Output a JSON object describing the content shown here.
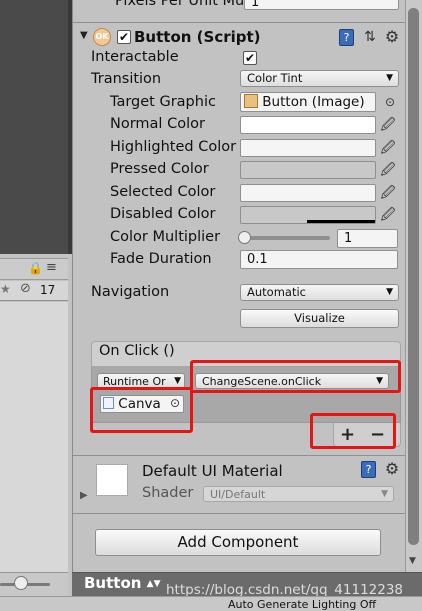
{
  "inspector": {
    "top_label": "Pixels Per Unit Mult",
    "top_value": "1",
    "component": {
      "title": "Button (Script)",
      "enabled": true
    },
    "interactable": {
      "label": "Interactable",
      "checked": true
    },
    "transition": {
      "label": "Transition",
      "value": "Color Tint"
    },
    "target_graphic": {
      "label": "Target Graphic",
      "value": "Button (Image)"
    },
    "normal_color": {
      "label": "Normal Color",
      "color": "#ffffff"
    },
    "highlighted_color": {
      "label": "Highlighted Color",
      "color": "#f5f5f5"
    },
    "pressed_color": {
      "label": "Pressed Color",
      "color": "#c8c8c8"
    },
    "selected_color": {
      "label": "Selected Color",
      "color": "#f5f5f5"
    },
    "disabled_color": {
      "label": "Disabled Color",
      "color": "#c8c8c8"
    },
    "color_multiplier": {
      "label": "Color Multiplier",
      "value": "1",
      "slider_fraction": 0
    },
    "fade_duration": {
      "label": "Fade Duration",
      "value": "0.1"
    },
    "navigation": {
      "label": "Navigation",
      "value": "Automatic",
      "visualize": "Visualize"
    },
    "on_click": {
      "header": "On Click ()",
      "runtime": "Runtime Or",
      "function": "ChangeScene.onClick",
      "object": "Canva",
      "add": "+",
      "remove": "−"
    },
    "material": {
      "name": "Default UI Material",
      "shader_label": "Shader",
      "shader_value": "UI/Default"
    },
    "add_component": "Add Component"
  },
  "left_panel": {
    "count": "17"
  },
  "bottom": {
    "selection": "Button",
    "watermark": "https://blog.csdn.net/qq_41112238",
    "status": "Auto Generate Lighting Off"
  }
}
